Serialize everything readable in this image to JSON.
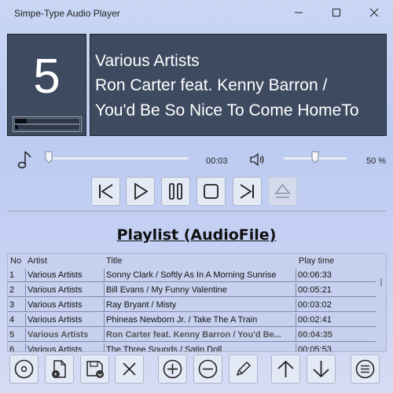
{
  "window": {
    "title": "Simpe-Type Audio Player"
  },
  "now_playing": {
    "track_number": "5",
    "artist": "Various Artists",
    "line2": "Ron Carter feat. Kenny Barron /",
    "line3": "You'd Be So Nice To Come HomeTo"
  },
  "level_meter": {
    "left": 0.18,
    "right": 0.05
  },
  "playback": {
    "elapsed": "00:03",
    "position_fraction": 0.01
  },
  "volume": {
    "label": "50 %",
    "value_fraction": 0.5
  },
  "controls": {
    "buttons": [
      "previous-icon",
      "play-icon",
      "pause-icon",
      "stop-icon",
      "next-icon",
      "eject-icon"
    ]
  },
  "playlist": {
    "title": "Playlist (AudioFile)",
    "columns": {
      "no": "No",
      "artist": "Artist",
      "title": "Title",
      "play_time": "Play time"
    },
    "rows": [
      {
        "no": "1",
        "artist": "Various Artists",
        "title": "Sonny Clark / Softly As In A Morning Sunrise",
        "time": "00:06:33"
      },
      {
        "no": "2",
        "artist": "Various Artists",
        "title": "Bill Evans / My Funny Valentine",
        "time": "00:05:21"
      },
      {
        "no": "3",
        "artist": "Various Artists",
        "title": "Ray Bryant / Misty",
        "time": "00:03:02"
      },
      {
        "no": "4",
        "artist": "Various Artists",
        "title": "Phineas Newborn Jr. / Take The A Train",
        "time": "00:02:41"
      },
      {
        "no": "5",
        "artist": "Various Artists",
        "title": "Ron Carter feat. Kenny Barron / You'd Be...",
        "time": "00:04:35"
      },
      {
        "no": "6",
        "artist": "Various Artists",
        "title": "The Three Sounds / Satin Doll",
        "time": "00:05:53"
      }
    ],
    "selected_index": 4
  },
  "toolbar": {
    "buttons": [
      "disc-icon",
      "open-file-icon",
      "save-icon",
      "clear-icon",
      "add-icon",
      "remove-icon",
      "edit-icon",
      "move-up-icon",
      "move-down-icon",
      "menu-icon"
    ]
  },
  "colors": {
    "display_bg": "#3d4a60",
    "window_bg": "#c9d6f4",
    "button_bg": "#e4e9f6"
  }
}
